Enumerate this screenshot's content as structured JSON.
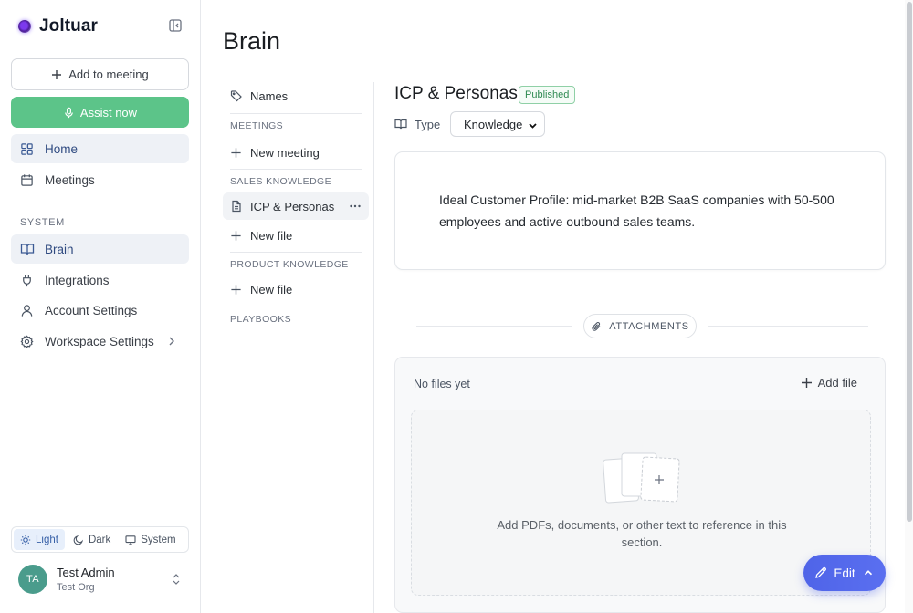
{
  "brand": {
    "name": "Joltuar"
  },
  "sidebar": {
    "add_to_meeting": "Add to meeting",
    "assist_now": "Assist now",
    "nav": [
      {
        "label": "Home",
        "icon": "home-grid-icon"
      },
      {
        "label": "Meetings",
        "icon": "calendar-icon"
      }
    ],
    "section_label": "SYSTEM",
    "system_nav": [
      {
        "label": "Brain",
        "icon": "book-icon"
      },
      {
        "label": "Integrations",
        "icon": "plug-icon"
      },
      {
        "label": "Account Settings",
        "icon": "user-icon"
      },
      {
        "label": "Workspace Settings",
        "icon": "gear-icon"
      }
    ],
    "theme": {
      "light": "Light",
      "dark": "Dark",
      "system": "System",
      "selected": "Light"
    },
    "user": {
      "initials": "TA",
      "name": "Test Admin",
      "org": "Test Org"
    }
  },
  "main": {
    "title": "Brain",
    "subnav": {
      "names": "Names",
      "meetings_label": "MEETINGS",
      "new_meeting": "New meeting",
      "sales_label": "SALES KNOWLEDGE",
      "sales_item": "ICP & Personas",
      "new_file_1": "New file",
      "product_label": "PRODUCT KNOWLEDGE",
      "new_file_2": "New file",
      "playbooks_label": "PLAYBOOKS"
    },
    "doc": {
      "title": "ICP & Personas",
      "status": "Published",
      "type_label": "Type",
      "type_value": "Knowledge",
      "content": "Ideal Customer Profile: mid-market B2B SaaS companies with 50-500 employees and active outbound sales teams."
    },
    "attachments": {
      "label": "ATTACHMENTS",
      "empty": "No files yet",
      "add_file": "Add file",
      "drop_text": "Add PDFs, documents, or other text to reference in this section."
    },
    "edit_button": "Edit"
  },
  "colors": {
    "accent_green": "#5cc489",
    "accent_blue": "#4f64e8",
    "published": "#2f8a52"
  }
}
